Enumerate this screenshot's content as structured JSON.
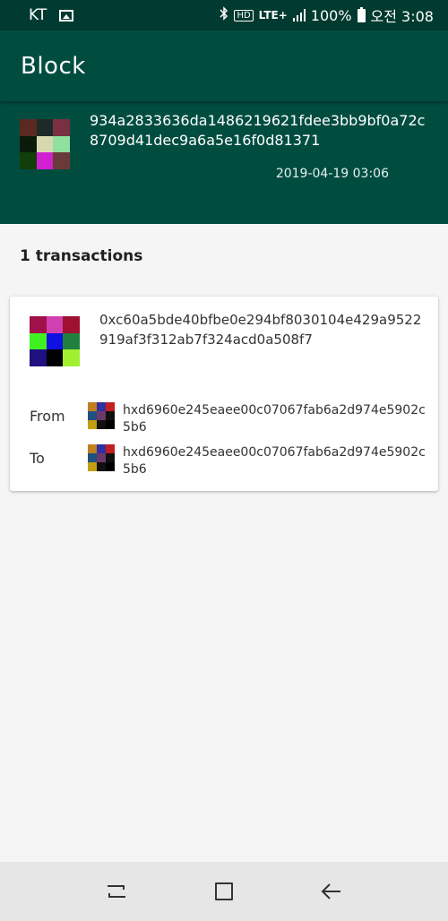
{
  "status_bar": {
    "carrier": "KT",
    "hd": "HD",
    "network": "LTE+",
    "battery": "100%",
    "time": "오전 3:08"
  },
  "app_bar": {
    "title": "Block"
  },
  "block": {
    "hash": "934a2833636da1486219621fdee3bb9bf0a72c8709d41dec9a6a5e16f0d81371",
    "timestamp": "2019-04-19 03:06",
    "identicon_colors": [
      "#5a2a20",
      "#1e2a2a",
      "#7a3040",
      "#0c1a0c",
      "#d8d8b0",
      "#90e0a0",
      "#123e0a",
      "#d020d0",
      "#6a3a3a"
    ]
  },
  "transactions_count_label": "1 transactions",
  "transaction": {
    "hash": "0xc60a5bde40bfbe0e294bf8030104e429a9522919af3f312ab7f324acd0a508f7",
    "identicon_colors": [
      "#a0104a",
      "#d040b0",
      "#a01030",
      "#40f020",
      "#1010e0",
      "#208040",
      "#201080",
      "#000000",
      "#a0f030"
    ],
    "from_label": "From",
    "from_address": "hxd6960e245eaee00c07067fab6a2d974e5902c5b6",
    "to_label": "To",
    "to_address": "hxd6960e245eaee00c07067fab6a2d974e5902c5b6",
    "address_identicon_colors": [
      "#c08020",
      "#3030a0",
      "#c02020",
      "#205080",
      "#6a3a6a",
      "#101010",
      "#c0a010",
      "#101010",
      "#000000"
    ]
  },
  "nav": {
    "recent_icon": "recent-apps-icon",
    "home_icon": "home-icon",
    "back_icon": "back-icon"
  }
}
